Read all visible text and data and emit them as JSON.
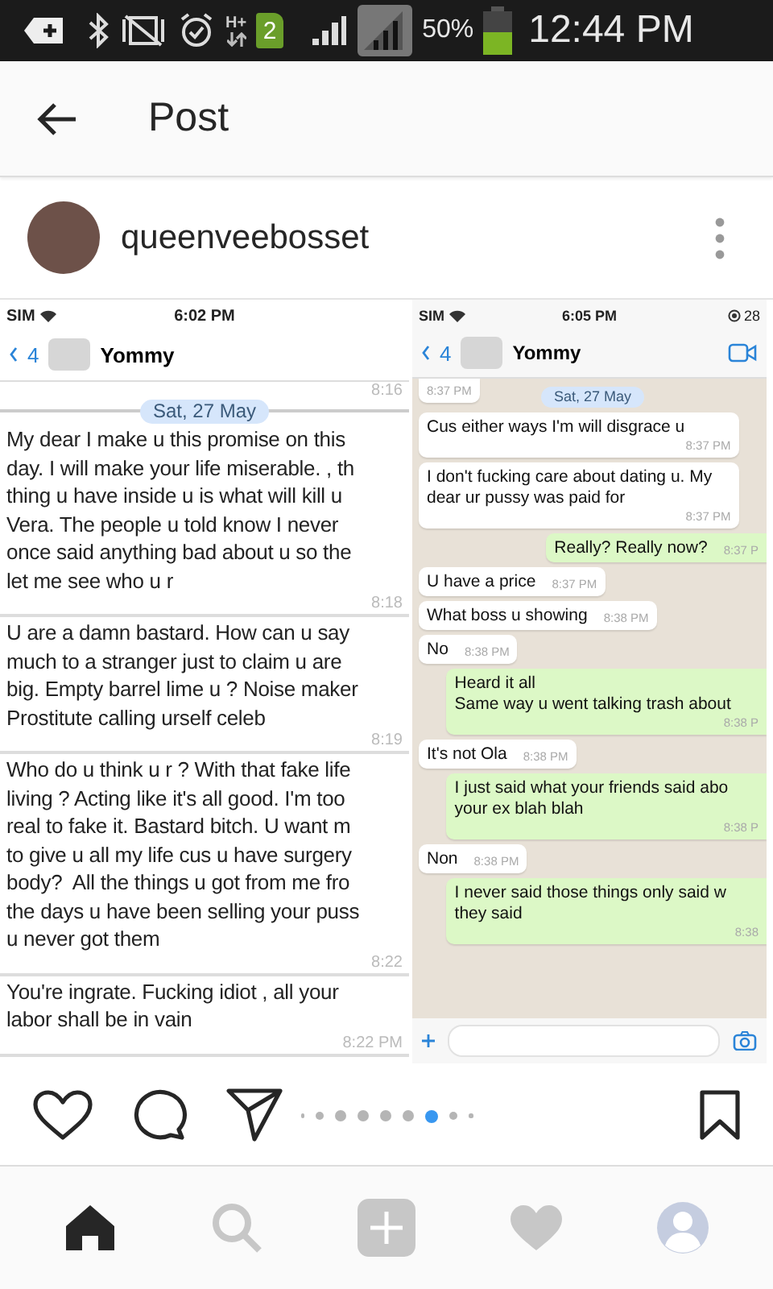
{
  "status_bar": {
    "network_type": "H+",
    "sim_badge": "2",
    "battery_percent": "50%",
    "time": "12:44 PM"
  },
  "app_bar": {
    "title": "Post"
  },
  "post": {
    "username": "queenveebosset",
    "screenshots": [
      {
        "kind": "plain",
        "status": {
          "carrier": "SIM",
          "time": "6:02 PM"
        },
        "header": {
          "back_count": "4",
          "contact": "Yommy"
        },
        "top_time": "8:16",
        "date_chip": "Sat, 27 May",
        "messages": [
          {
            "text": "My dear I make u this promise on this\nday. I will make your life miserable. , th\nthing u have inside u is what will kill u\nVera. The people u told know I never\nonce said anything bad about u so the\nlet me see who u r",
            "time": "8:18"
          },
          {
            "text": "U are a damn bastard. How can u say\nmuch to a stranger just to claim u are\nbig. Empty barrel lime u ? Noise maker\nProstitute calling urself celeb",
            "time": "8:19"
          },
          {
            "text": "Who do u think u r ? With that fake life\nliving ? Acting like it's all good. I'm too\nreal to fake it. Bastard bitch. U want m\nto give u all my life cus u have surgery\nbody?  All the things u got from me fro\nthe days u have been selling your puss\nu never got them",
            "time": "8:22"
          },
          {
            "text": "You're ingrate. Fucking idiot , all your\nlabor shall be in vain",
            "time": "8:22 PM"
          }
        ]
      },
      {
        "kind": "whatsapp",
        "status": {
          "carrier": "SIM",
          "time": "6:05 PM",
          "battery": "28"
        },
        "header": {
          "back_count": "4",
          "contact": "Yommy"
        },
        "top_time": "8:37 PM",
        "date_chip": "Sat, 27 May",
        "messages": [
          {
            "kind": "incoming",
            "text": "Cus either ways I'm will disgrace u",
            "time": "8:37 PM"
          },
          {
            "kind": "incoming",
            "text": "I don't fucking care about dating u. My\ndear ur pussy was paid for",
            "time": "8:37 PM"
          },
          {
            "kind": "outgoing",
            "text": "Really? Really now?",
            "time": "8:37 P"
          },
          {
            "kind": "incoming",
            "text": "U have a price",
            "time": "8:37 PM"
          },
          {
            "kind": "incoming",
            "text": "What boss u showing",
            "time": "8:38 PM"
          },
          {
            "kind": "incoming",
            "text": "No",
            "time": "8:38 PM"
          },
          {
            "kind": "outgoing",
            "text": "Heard it all\nSame way u went talking trash about",
            "time": "8:38 P"
          },
          {
            "kind": "incoming",
            "text": "It's not Ola",
            "time": "8:38 PM"
          },
          {
            "kind": "outgoing",
            "text": "I just said what your friends said abo\nyour ex blah blah",
            "time": "8:38 P"
          },
          {
            "kind": "incoming",
            "text": "Non",
            "time": "8:38 PM"
          },
          {
            "kind": "outgoing",
            "text": "I never said those things only said w\nthey said",
            "time": "8:38"
          }
        ]
      }
    ],
    "carousel_dots": [
      {
        "kind": "tiny",
        "selected": false
      },
      {
        "kind": "small",
        "selected": false
      },
      {
        "kind": "full",
        "selected": false
      },
      {
        "kind": "full",
        "selected": false
      },
      {
        "kind": "full",
        "selected": false
      },
      {
        "kind": "full",
        "selected": false
      },
      {
        "kind": "full",
        "selected": true
      },
      {
        "kind": "small",
        "selected": false
      },
      {
        "kind": "tiny",
        "selected": false
      }
    ]
  },
  "bottom_nav": [
    {
      "kind": "home",
      "selected": true
    },
    {
      "kind": "search",
      "selected": false
    },
    {
      "kind": "add",
      "selected": false
    },
    {
      "kind": "activity",
      "selected": false
    },
    {
      "kind": "profile",
      "selected": false
    }
  ]
}
